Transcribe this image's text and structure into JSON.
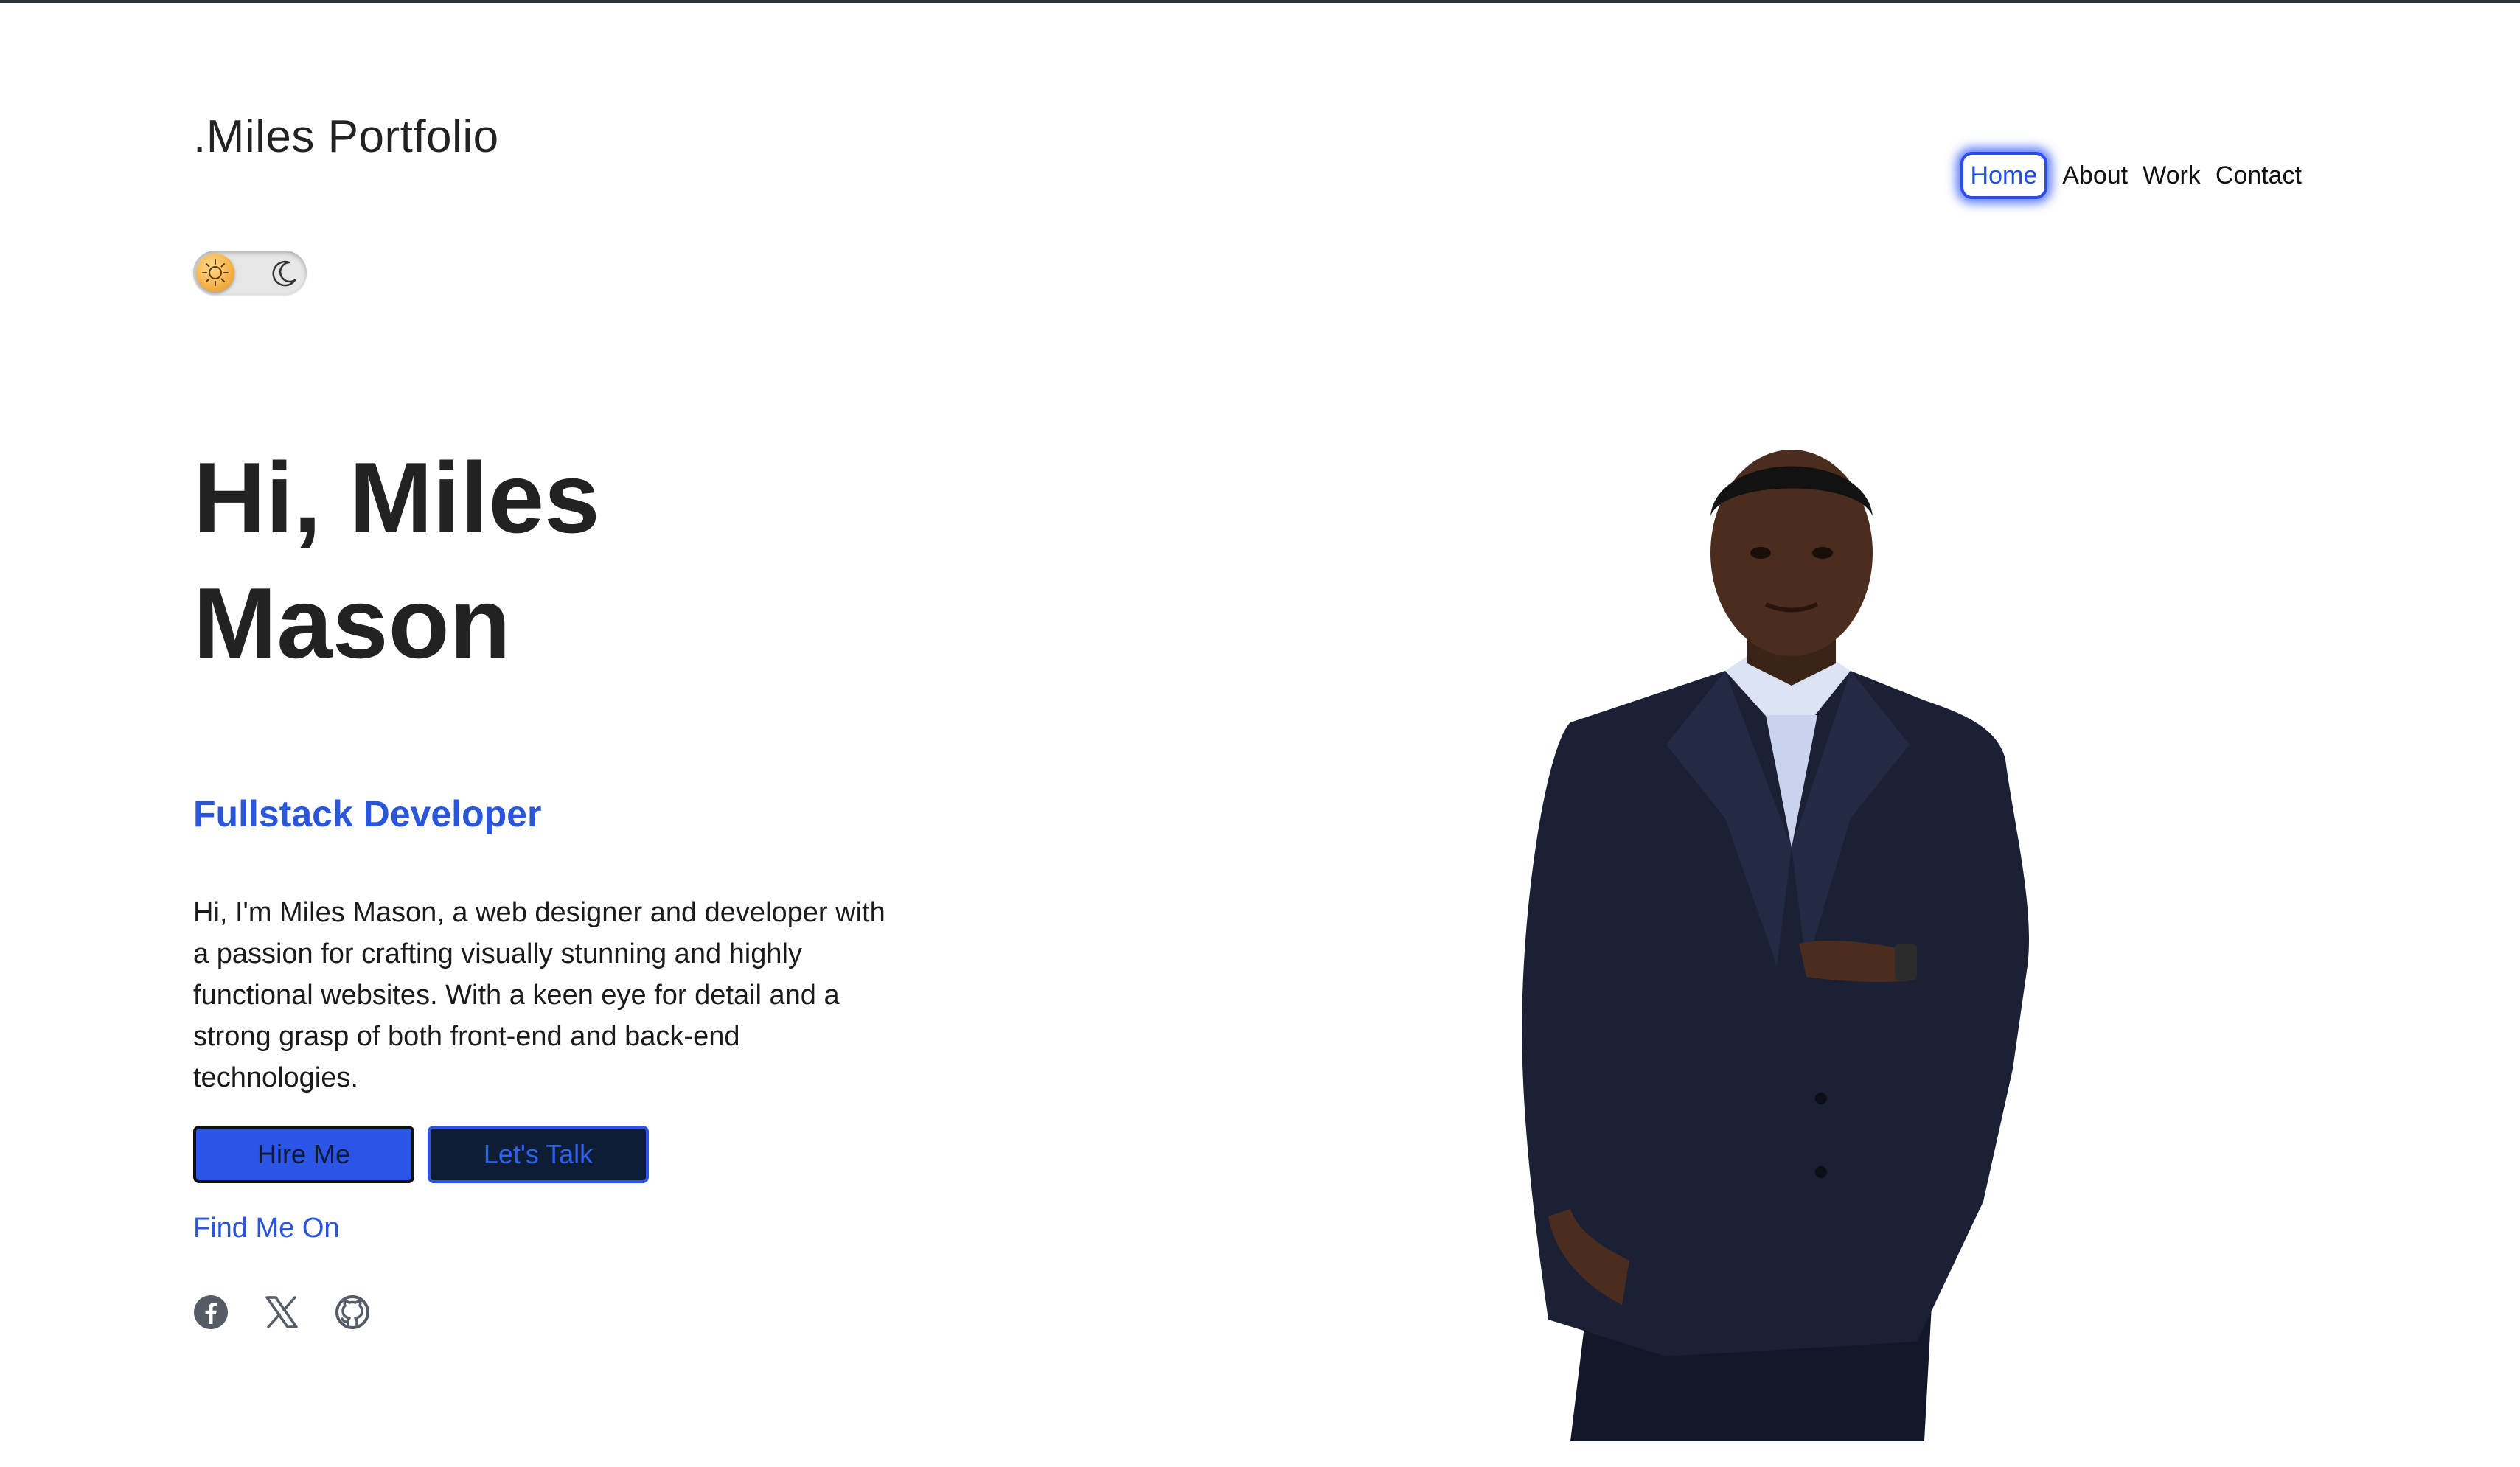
{
  "header": {
    "logo": ".Miles Portfolio",
    "nav": [
      {
        "label": "Home",
        "active": true
      },
      {
        "label": "About",
        "active": false
      },
      {
        "label": "Work",
        "active": false
      },
      {
        "label": "Contact",
        "active": false
      }
    ]
  },
  "theme_toggle": {
    "state": "light",
    "icons": [
      "sun-icon",
      "moon-icon"
    ]
  },
  "hero": {
    "title_line1": "Hi, Miles",
    "title_line2": "Mason",
    "subtitle": "Fullstack Developer",
    "bio": "Hi, I'm Miles Mason, a web designer and developer with a passion for crafting visually stunning and highly functional websites. With a keen eye for detail and a strong grasp of both front-end and back-end technologies.",
    "hire_button": "Hire Me",
    "talk_button": "Let's Talk",
    "find_me": "Find Me On",
    "socials": [
      "facebook-icon",
      "x-twitter-icon",
      "github-icon"
    ]
  },
  "colors": {
    "accent": "#2a56dc",
    "button_primary": "#2b55e6",
    "button_dark": "#0f1c35",
    "text": "#222222"
  }
}
